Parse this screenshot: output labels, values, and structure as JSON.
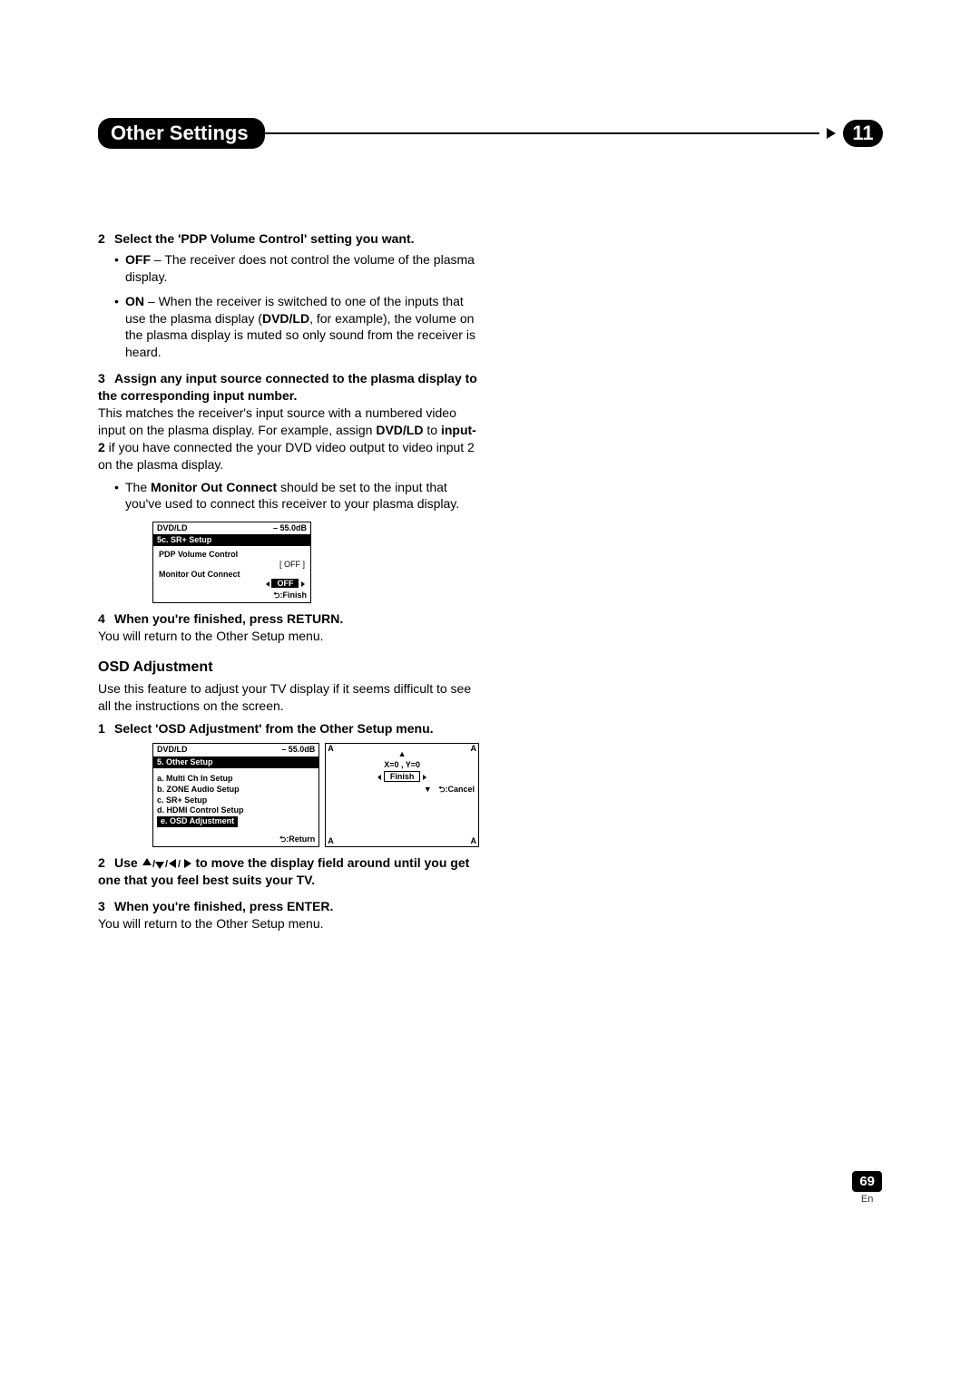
{
  "header": {
    "title": "Other Settings",
    "chapter": "11"
  },
  "steps": {
    "s2": {
      "head": "Select the 'PDP Volume Control' setting you want.",
      "off_label": "OFF",
      "off_text": " – The receiver does not control the volume of the plasma display.",
      "on_label": "ON",
      "on_text": " – When the receiver is switched to one of the inputs that use the plasma display (",
      "on_bold1": "DVD/LD",
      "on_text2": ", for example), the volume on the plasma display is muted so only sound from the receiver is heard."
    },
    "s3": {
      "head": "Assign any input source connected to the plasma display to the corresponding input number.",
      "body1": "This matches the receiver's input source with a numbered video input on the plasma display. For example, assign ",
      "bold1": "DVD/LD",
      "body2": " to ",
      "bold2": "input-2",
      "body3": " if you have connected the your DVD video output to video input 2 on the plasma display.",
      "bullet_pre": "The ",
      "bullet_bold": "Monitor Out Connect",
      "bullet_post": " should be set to the input that you've used to connect this receiver to your plasma display."
    },
    "s4": {
      "head": "When you're finished, press RETURN.",
      "body": "You will return to the Other Setup menu."
    },
    "osd_title": "OSD Adjustment",
    "osd_intro": "Use this feature to adjust your TV display if it seems difficult to see all the instructions on the screen.",
    "o1": {
      "head": "Select 'OSD Adjustment' from the Other Setup menu."
    },
    "o2": {
      "pre": "Use ",
      "post": " to move the display field around until you get one that you feel best suits your TV."
    },
    "o3": {
      "head": "When you're finished, press ENTER.",
      "body": "You will return to the Other Setup menu."
    }
  },
  "osd1": {
    "src": "DVD/LD",
    "db": "– 55.0dB",
    "menu": "5c. SR+ Setup",
    "l1": "PDP Volume Control",
    "v1": "[   OFF   ]",
    "l2": "Monitor Out Connect",
    "v2": "OFF",
    "finish": ":Finish"
  },
  "osd_left": {
    "src": "DVD/LD",
    "db": "– 55.0dB",
    "menu": "5. Other Setup",
    "a": "a. Multi Ch In Setup",
    "b": "b. ZONE Audio Setup",
    "c": "c. SR+ Setup",
    "d": "d. HDMI Control Setup",
    "e": "e. OSD Adjustment",
    "ret": ":Return"
  },
  "osd_right": {
    "A": "A",
    "up": "▲",
    "coord": "X=0  , Y=0",
    "finish": "Finish",
    "down": "▼",
    "cancel": ":Cancel"
  },
  "footer": {
    "page": "69",
    "lang": "En"
  }
}
